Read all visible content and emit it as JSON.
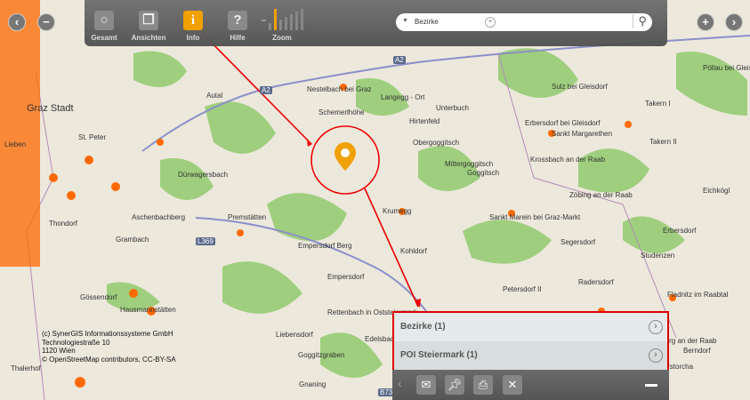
{
  "toolbar": {
    "items": [
      {
        "label": "Gesamt",
        "icon": "circle-icon"
      },
      {
        "label": "Ansichten",
        "icon": "layers-icon"
      },
      {
        "label": "Info",
        "icon": "info-icon",
        "active": true
      },
      {
        "label": "Hilfe",
        "icon": "help-icon"
      },
      {
        "label": "Zoom",
        "icon": "zoom-slider-icon"
      }
    ]
  },
  "search": {
    "value": "Bezirke"
  },
  "map": {
    "road_labels": [
      "A2",
      "A2",
      "L369",
      "B73"
    ],
    "places": [
      "Graz Stadt",
      "St. Peter",
      "Lieben",
      "Thondorf",
      "Grambach",
      "Gössendorf",
      "Hausmannstätten",
      "Thalerhof",
      "Autal",
      "Dürwagersbach",
      "Aschenbachberg",
      "Premstätten",
      "Nestelbach bei Graz",
      "Schemerlhöhe",
      "Langegg - Ort",
      "Unterbuch",
      "Hirtenfeld",
      "Obergoggitsch",
      "Mittergoggitsch",
      "Goggitsch",
      "Erbersdorf bei Gleisdorf",
      "Sankt Margarethen",
      "Takern II",
      "Takern I",
      "Sulz bei Gleisdorf",
      "Pöllau bei Gleisdorf",
      "Krossbach an der Raab",
      "Zöbing an der Raab",
      "Eichkögl",
      "Krumegg",
      "Sankt Marein bei Graz-Markt",
      "Empersdorf Berg",
      "Empersdorf",
      "Kohldorf",
      "Segersdorf",
      "Erbersdorf",
      "Studenzen",
      "Petersdorf II",
      "Radersdorf",
      "Fladnitz im Raabtal",
      "Liebensdorf",
      "Rettenbach in Oststeiermark",
      "Edelsbach",
      "Goggitzgraben",
      "Gnaning",
      "Kirchberg an der Raab",
      "Berndorf",
      "Oberstorcha"
    ]
  },
  "copyright": [
    "(c) SynerGIS Informationssysteme GmbH",
    "Technologiestraße 10",
    "1120 Wien",
    "© OpenStreetMap contributors, CC-BY-SA"
  ],
  "results": [
    {
      "label": "Bezirke (1)"
    },
    {
      "label": "POI Steiermark (1)"
    }
  ],
  "colors": {
    "accent": "#f0a000",
    "highlight": "#dd0000",
    "poi": "#ff6a00"
  }
}
